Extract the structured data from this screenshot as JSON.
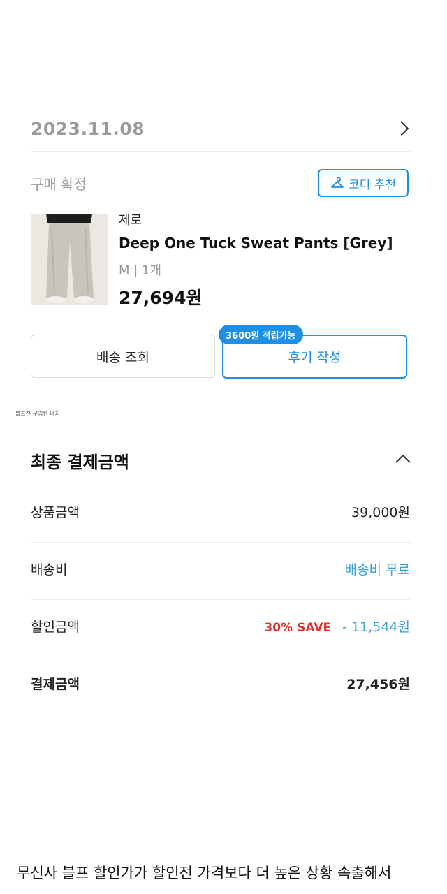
{
  "order": {
    "date": "2023.11.08",
    "status": "구매 확정",
    "codi_button": "코디 추천",
    "item": {
      "brand": "제로",
      "name": "Deep One Tuck Sweat Pants [Grey]",
      "option": "M  |  1개",
      "price": "27,694원"
    },
    "buttons": {
      "shipping": "배송 조회",
      "review": "후기 작성",
      "reward_badge": "3600원 적립가능"
    }
  },
  "caption_small": "블프전 구입한 바지",
  "payment": {
    "title": "최종 결제금액",
    "rows": [
      {
        "label": "상품금액",
        "value": "39,000원"
      },
      {
        "label": "배송비",
        "value": "배송비 무료"
      },
      {
        "label": "할인금액",
        "save": "30% SAVE",
        "value": "- 11,544원"
      },
      {
        "label": "결제금액",
        "value": "27,456원"
      }
    ]
  },
  "bottom_caption": "무신사 블프 할인가가 할인전 가격보다 더 높은 상황 속출해서",
  "colors": {
    "accent": "#1f8fe5",
    "save": "#e03131",
    "free_shipping": "#3aa0dc"
  }
}
